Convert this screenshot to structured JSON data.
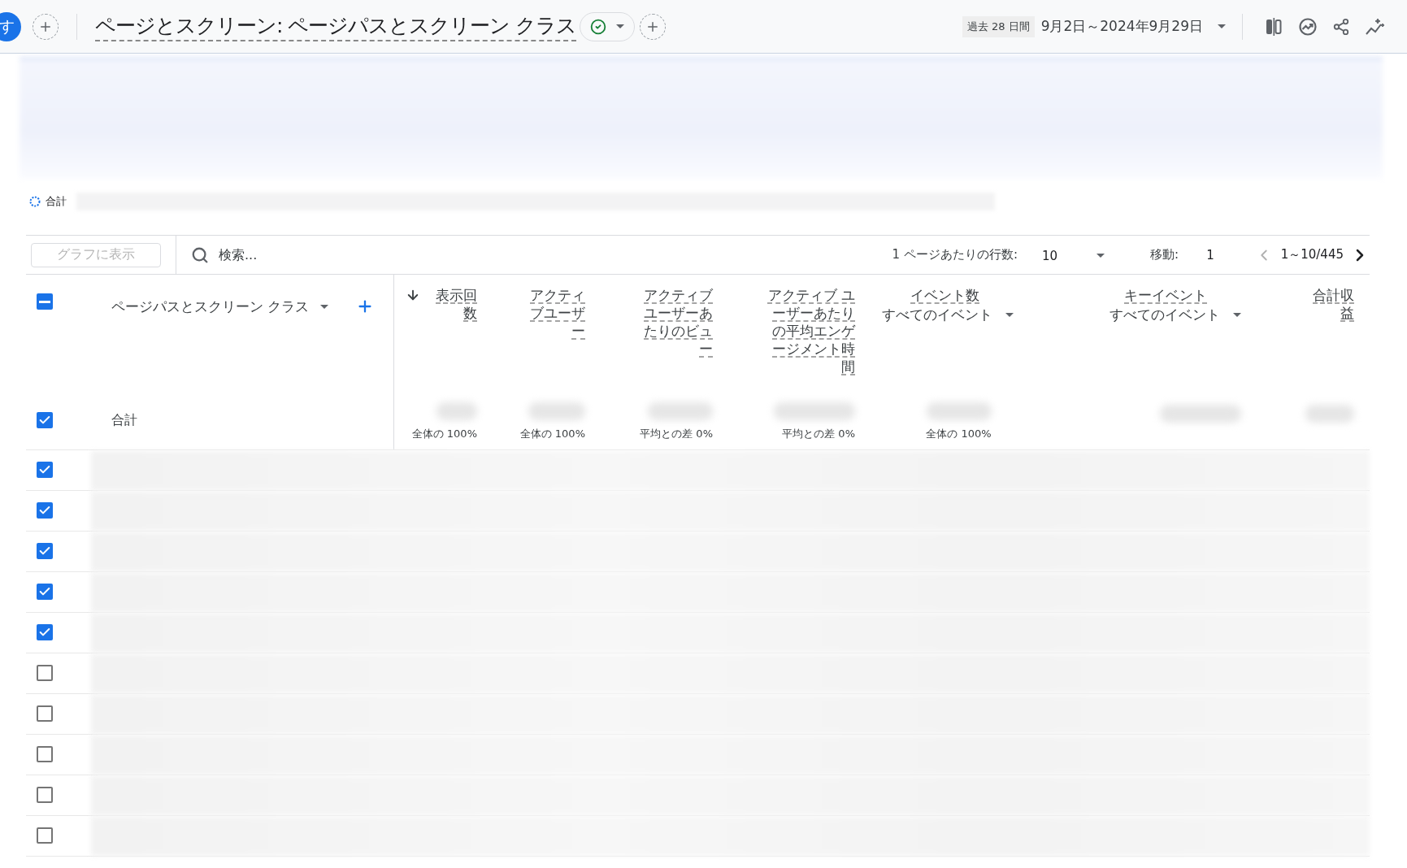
{
  "top_bar": {
    "avatar": "す",
    "title": "ページとスクリーン: ページパスとスクリーン クラス",
    "status_ok": true,
    "date_chip": "過去 28 日間",
    "date_range": "9月2日～2024年9月29日"
  },
  "legend": {
    "label": "合計"
  },
  "toolbar": {
    "chart_button": {
      "label": "グラフに表示",
      "disabled": true
    },
    "search": {
      "placeholder": "検索..."
    },
    "rows_label": "1 ページあたりの行数:",
    "rows_value": "10",
    "goto_label": "移動:",
    "goto_value": "1",
    "range": "1～10/445",
    "prev_disabled": true
  },
  "table": {
    "header_partial": true,
    "dimension": "ページパスとスクリーン クラス",
    "columns": [
      {
        "label": "表示回数",
        "sorted": true,
        "total_note": "全体の 100%"
      },
      {
        "label": "アクティブユーザー",
        "sorted": false,
        "total_note": "全体の 100%"
      },
      {
        "label": "アクティブユーザーあたりのビュー",
        "sorted": false,
        "total_note": "平均との差 0%"
      },
      {
        "label": "アクティブ ユーザーあたりの平均エンゲージメント時間",
        "sorted": false,
        "total_note": "平均との差 0%"
      },
      {
        "label": "イベント数",
        "sorted": false,
        "filter": "すべてのイベント",
        "total_note": "全体の 100%"
      },
      {
        "label": "キーイベント",
        "sorted": false,
        "filter": "すべてのイベント"
      },
      {
        "label": "合計収益",
        "sorted": false
      }
    ],
    "total_row": {
      "label": "合計",
      "checked": true
    },
    "rows": [
      {
        "checked": true
      },
      {
        "checked": true
      },
      {
        "checked": true
      },
      {
        "checked": true
      },
      {
        "checked": true
      },
      {
        "checked": false
      },
      {
        "checked": false
      },
      {
        "checked": false
      },
      {
        "checked": false
      },
      {
        "checked": false
      }
    ]
  }
}
